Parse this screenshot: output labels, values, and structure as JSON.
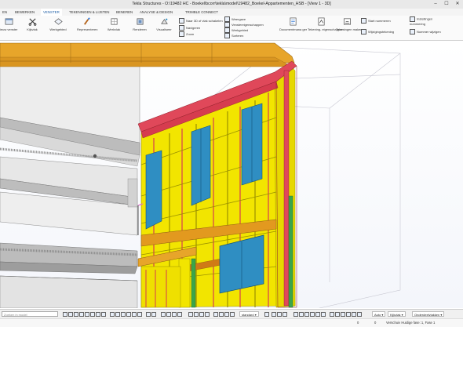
{
  "window": {
    "title": "Tekla Structures - O:\\19482 HC - Boekel\\bcorr\\tekla\\model\\19482_Boekel-Appartementen_HSB - [View 1 - 3D]"
  },
  "menu": {
    "tabs": [
      {
        "label": "EN"
      },
      {
        "label": "BEWERKEN"
      },
      {
        "label": "VENSTER"
      },
      {
        "label": "TEKENINGEN & LIJSTEN"
      },
      {
        "label": "BENEREN"
      },
      {
        "label": "ANALYSE & DESIGN"
      },
      {
        "label": "TRIMBLE CONNECT"
      }
    ],
    "active": "VENSTER"
  },
  "ribbon": {
    "large_buttons": [
      {
        "label": "ieuw venster",
        "icon": "new-window-icon"
      },
      {
        "label": "Kijkvlak",
        "icon": "scissors-icon"
      },
      {
        "label": "Werkgebied",
        "icon": "workarea-icon"
      },
      {
        "label": "Representeren",
        "icon": "paint-brush-icon"
      },
      {
        "label": "Werkvlak",
        "icon": "workplane-icon"
      },
      {
        "label": "Renderen",
        "icon": "render-icon"
      },
      {
        "label": "Visualiseer",
        "icon": "visualize-icon"
      },
      {
        "label": "Documentmana ger",
        "icon": "document-manager-icon"
      },
      {
        "label": "Tekening- eigenschappen",
        "icon": "drawing-properties-icon"
      },
      {
        "label": "Tekeningen maken",
        "icon": "create-drawings-icon"
      }
    ],
    "small_buttons": [
      {
        "label": "Naar 3D of vlak schakelen",
        "icon": "switch-3d-icon"
      },
      {
        "label": "Navigeren",
        "icon": "navigate-icon"
      },
      {
        "label": "Zoom",
        "icon": "zoom-icon"
      },
      {
        "label": "Weergave",
        "icon": "view-icon"
      },
      {
        "label": "Venstereigenschappen",
        "icon": "window-properties-icon"
      },
      {
        "label": "Werkgebied",
        "icon": "workarea-small-icon"
      },
      {
        "label": "Sorteren",
        "icon": "sort-icon"
      },
      {
        "label": "Start nummeren",
        "icon": "start-numbering-icon"
      },
      {
        "label": "Instellingen nummering",
        "icon": "numbering-settings-icon"
      },
      {
        "label": "Wijzigingstekening",
        "icon": "revision-drawing-icon"
      },
      {
        "label": "Nummer wijzigen",
        "icon": "change-number-icon"
      }
    ]
  },
  "statusbar": {
    "search_placeholder": "Zoeken in model",
    "view_mode": "standard",
    "auto": "Auto",
    "snap": "Kijkvlak",
    "selection": "Onderdeelvlakken"
  },
  "infobar": {
    "value1": "0",
    "value2": "0",
    "message": "Verschuiv Huidige fase: 1, Fase 1"
  },
  "colors": {
    "timber_yellow": "#f2e500",
    "timber_edge": "#9b9100",
    "top_plate_red": "#e0485a",
    "ledger_orange": "#e2991f",
    "window_blue": "#2f8ec2",
    "concrete_gray": "#b9b9b9",
    "green_beam": "#3aa54a",
    "accent": "#1f5fa6"
  }
}
